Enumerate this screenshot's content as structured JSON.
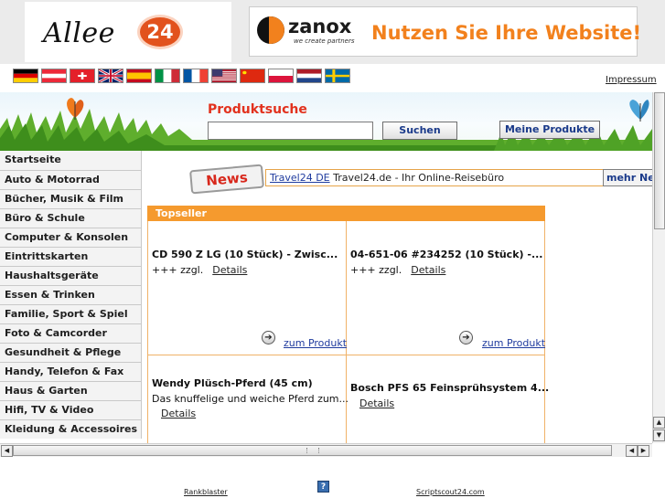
{
  "header": {
    "logo_text": "Allee",
    "logo_badge": "24",
    "ad": {
      "brand": "zanox",
      "tagline": "we create partners",
      "text": "Nutzen Sie Ihre Website!"
    }
  },
  "flags": [
    "DE",
    "AT",
    "CH",
    "GB",
    "ES",
    "IT",
    "FR",
    "US",
    "CN",
    "PL",
    "NL",
    "SE"
  ],
  "impressum": "Impressum",
  "search": {
    "title": "Produktsuche",
    "input_value": "",
    "search_button": "Suchen",
    "my_products_button": "Meine Produkte"
  },
  "nav": [
    "Startseite",
    "Auto & Motorrad",
    "Bücher, Musik & Film",
    "Büro & Schule",
    "Computer & Konsolen",
    "Eintrittskarten",
    "Haushaltsgeräte",
    "Essen & Trinken",
    "Familie, Sport & Spiel",
    "Foto & Camcorder",
    "Gesundheit & Pflege",
    "Handy, Telefon & Fax",
    "Haus & Garten",
    "Hifi, TV & Video",
    "Kleidung & Accessoires"
  ],
  "news": {
    "badge": "News",
    "link": "Travel24 DE",
    "description": "Travel24.de - Ihr Online-Reisebüro",
    "more": "mehr News"
  },
  "topseller": {
    "header": "Topseller",
    "products": [
      {
        "title": "CD 590 Z LG (10 Stück) - Zwisc...",
        "price": "+++ zzgl.",
        "details": "Details",
        "goto": "zum Produkt"
      },
      {
        "title": "04-651-06 #234252 (10 Stück) -...",
        "price": "+++ zzgl.",
        "details": "Details",
        "goto": "zum Produkt"
      },
      {
        "title": "Wendy Plüsch-Pferd (45 cm)",
        "description": "Das knuffelige und weiche Pferd zum...",
        "details": "Details"
      },
      {
        "title": "Bosch PFS 65 Feinsprühsystem 4...",
        "details": "Details"
      }
    ]
  },
  "footer": {
    "left": "Rankblaster",
    "icon": "?",
    "right": "Scriptscout24.com"
  },
  "colors": {
    "accent_orange": "#f59a2e",
    "search_title_red": "#e2321e",
    "link_blue": "#1f3b9e"
  }
}
